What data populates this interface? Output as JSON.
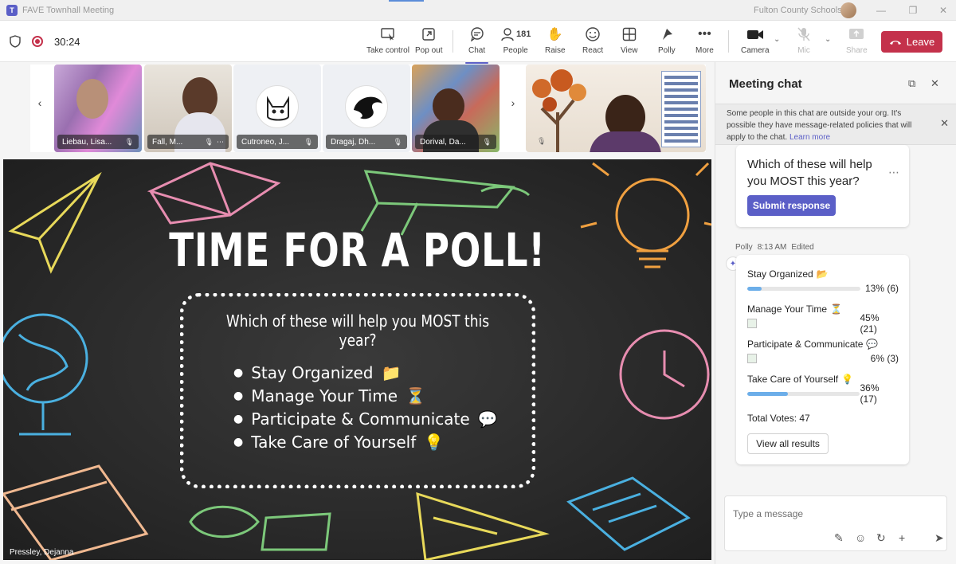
{
  "titlebar": {
    "title": "FAVE Townhall Meeting",
    "org": "Fulton County Schools"
  },
  "toolbar": {
    "timer": "30:24",
    "take_control": "Take control",
    "pop_out": "Pop out",
    "chat": "Chat",
    "people": "People",
    "people_count": "181",
    "raise": "Raise",
    "react": "React",
    "view": "View",
    "polly": "Polly",
    "more": "More",
    "camera": "Camera",
    "mic": "Mic",
    "share": "Share",
    "leave": "Leave"
  },
  "participants": [
    {
      "name": "Liebau, Lisa..."
    },
    {
      "name": "Fall, M..."
    },
    {
      "name": "Cutroneo, J..."
    },
    {
      "name": "Dragaj, Dh..."
    },
    {
      "name": "Dorival, Da..."
    }
  ],
  "stage": {
    "title": "TIME FOR A POLL!",
    "question": "Which of these will help you MOST this year?",
    "items": [
      {
        "text": "Stay Organized",
        "emoji": "📁"
      },
      {
        "text": "Manage Your Time",
        "emoji": "⏳"
      },
      {
        "text": "Participate & Communicate",
        "emoji": "💬"
      },
      {
        "text": "Take Care of Yourself",
        "emoji": "💡"
      }
    ],
    "presenter": "Pressley, Dejanna"
  },
  "chat": {
    "header": "Meeting chat",
    "notice": "Some people in this chat are outside your org. It's possible they have message-related policies that will apply to the chat.",
    "notice_link": "Learn more",
    "poll_question": "Which of these will help you MOST this year?",
    "submit": "Submit response",
    "author": "Polly",
    "time": "8:13 AM",
    "edited": "Edited",
    "results": [
      {
        "label": "Stay Organized",
        "emoji": "📂",
        "pct": "13% (6)",
        "fraction": 0.13,
        "bar": true
      },
      {
        "label": "Manage Your Time",
        "emoji": "⏳",
        "pct": "45% (21)",
        "fraction": 0.45,
        "bar": false
      },
      {
        "label": "Participate & Communicate",
        "emoji": "💬",
        "pct": "6% (3)",
        "fraction": 0.06,
        "bar": false
      },
      {
        "label": "Take Care of Yourself",
        "emoji": "💡",
        "pct": "36% (17)",
        "fraction": 0.36,
        "bar": true
      }
    ],
    "total": "Total Votes: 47",
    "view_all": "View all results",
    "composer_placeholder": "Type a message"
  },
  "colors": {
    "accent": "#5b5fc7",
    "leave": "#c4314b",
    "bar_fill": "#6caee9"
  }
}
